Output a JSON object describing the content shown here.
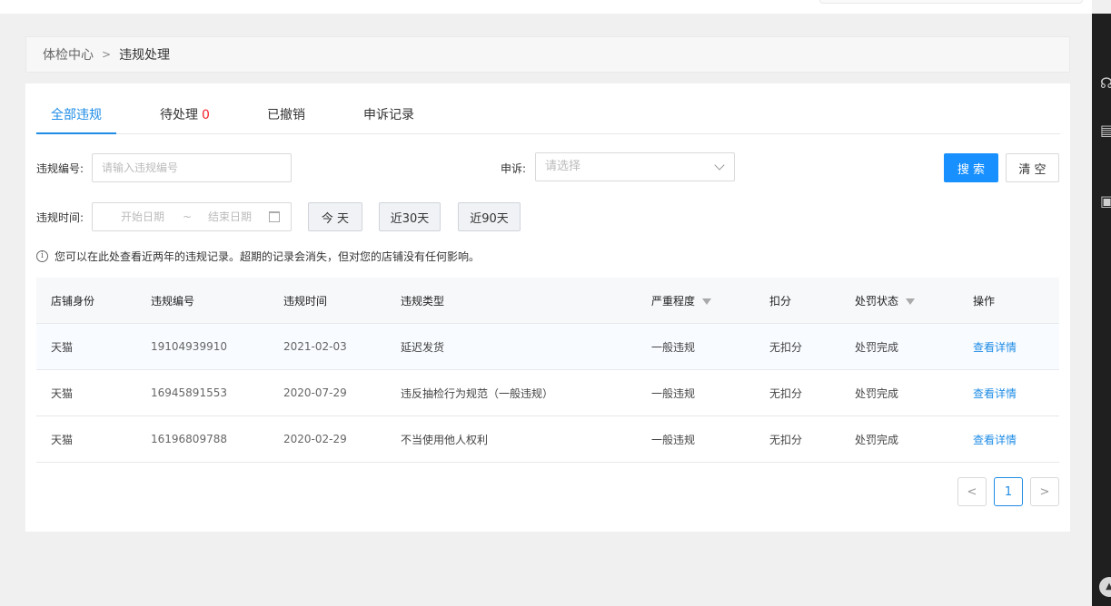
{
  "breadcrumb": {
    "parent": "体检中心",
    "separator": ">",
    "current": "违规处理"
  },
  "tabs": [
    {
      "label": "全部违规"
    },
    {
      "label": "待处理",
      "badge": "0"
    },
    {
      "label": "已撤销"
    },
    {
      "label": "申诉记录"
    }
  ],
  "filters": {
    "code_label": "违规编号",
    "code_placeholder": "请输入违规编号",
    "appeal_label": "申诉",
    "appeal_placeholder": "请选择",
    "time_label": "违规时间",
    "start_placeholder": "开始日期",
    "range_sep": "~",
    "end_placeholder": "结束日期",
    "colon": ":",
    "today_btn": "今 天",
    "last30_btn": "近30天",
    "last90_btn": "近90天",
    "search_btn": "搜 索",
    "clear_btn": "清 空"
  },
  "tip": {
    "icon": "info-icon",
    "text": "您可以在此处查看近两年的违规记录。超期的记录会消失，但对您的店铺没有任何影响。"
  },
  "table": {
    "headers": [
      "店铺身份",
      "违规编号",
      "违规时间",
      "违规类型",
      "严重程度",
      "扣分",
      "处罚状态",
      "操作"
    ],
    "rows": [
      {
        "shop": "天猫",
        "code": "19104939910",
        "date": "2021-02-03",
        "type": "延迟发货",
        "severity": "一般违规",
        "points": "无扣分",
        "status": "处罚完成",
        "action": "查看详情"
      },
      {
        "shop": "天猫",
        "code": "16945891553",
        "date": "2020-07-29",
        "type": "违反抽检行为规范（一般违规）",
        "severity": "一般违规",
        "points": "无扣分",
        "status": "处罚完成",
        "action": "查看详情"
      },
      {
        "shop": "天猫",
        "code": "16196809788",
        "date": "2020-02-29",
        "type": "不当使用他人权利",
        "severity": "一般违规",
        "points": "无扣分",
        "status": "处罚完成",
        "action": "查看详情"
      }
    ]
  },
  "pagination": {
    "prev": "<",
    "current": "1",
    "next": ">"
  },
  "colors": {
    "accent": "#1f8ce6",
    "primary_button": "#1890ff",
    "badge": "#f5222d",
    "rail": "#1f1f1f"
  }
}
